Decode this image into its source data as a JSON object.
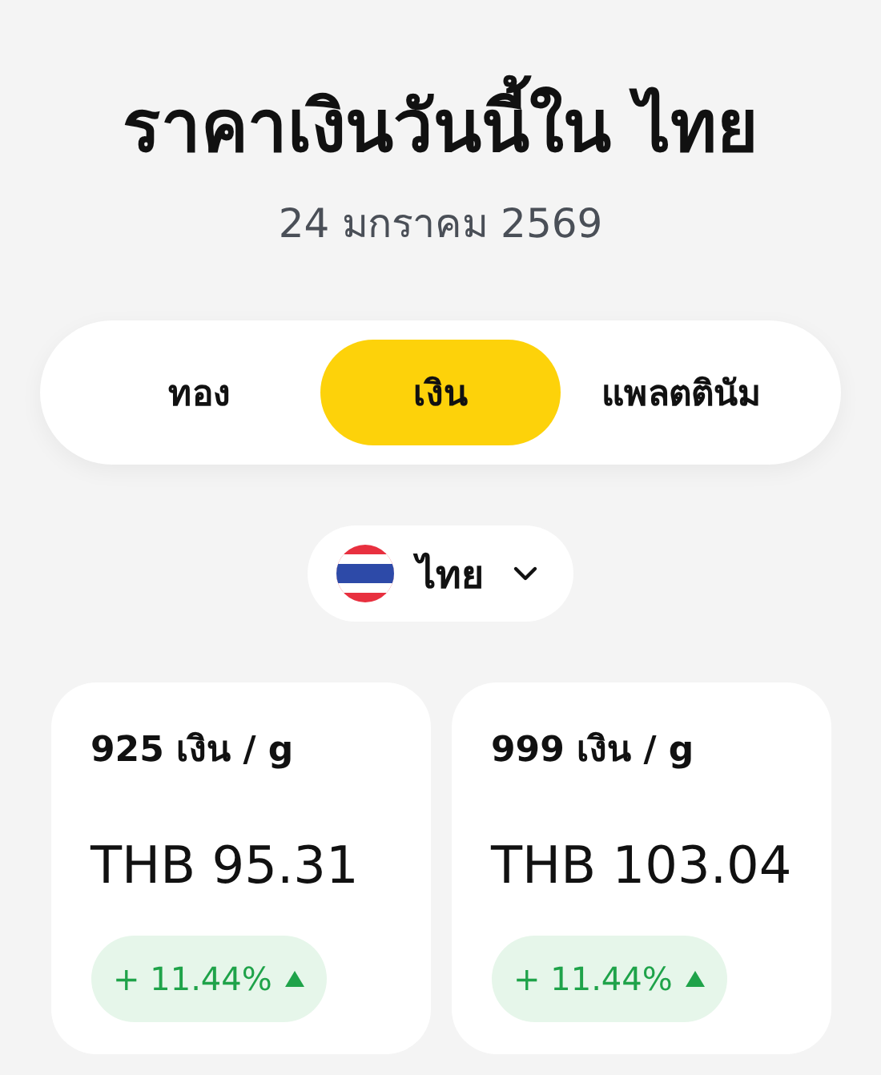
{
  "title": "ราคาเงินวันนี้ใน ไทย",
  "date": "24 มกราคม 2569",
  "tabs": [
    {
      "label": "ทอง",
      "selected": false
    },
    {
      "label": "เงิน",
      "selected": true
    },
    {
      "label": "แพลตตินัม",
      "selected": false
    }
  ],
  "country_selector": {
    "label": "ไทย"
  },
  "cards": [
    {
      "title": "925 เงิน / g",
      "price": "THB 95.31",
      "change": "+ 11.44%",
      "rising": true
    },
    {
      "title": "999 เงิน / g",
      "price": "THB 103.04",
      "change": "+ 11.44%",
      "rising": true
    }
  ]
}
